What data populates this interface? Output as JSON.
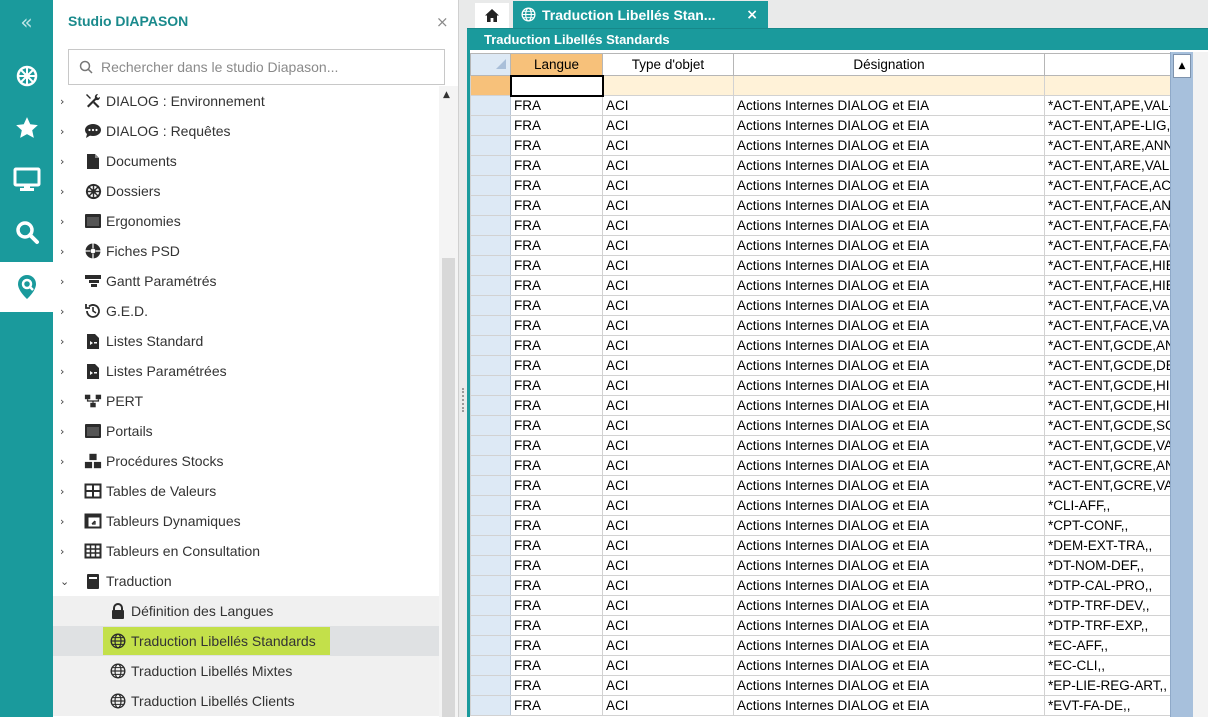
{
  "rail": {
    "collapse": "«",
    "items": [
      {
        "name": "dossier-wheel-icon",
        "active": false
      },
      {
        "name": "star-icon",
        "active": false
      },
      {
        "name": "monitor-icon",
        "active": false
      },
      {
        "name": "search-icon",
        "active": false
      },
      {
        "name": "map-search-icon",
        "active": true
      }
    ]
  },
  "panel": {
    "title": "Studio DIAPASON",
    "close": "×",
    "search_placeholder": "Rechercher dans le studio Diapason..."
  },
  "tree": {
    "items": [
      {
        "label": "DIALOG : Environnement",
        "icon": "tools-icon",
        "chevron": "›"
      },
      {
        "label": "DIALOG : Requêtes",
        "icon": "chat-bubble-icon",
        "chevron": "›"
      },
      {
        "label": "Documents",
        "icon": "document-icon",
        "chevron": "›"
      },
      {
        "label": "Dossiers",
        "icon": "gear-wheel-icon",
        "chevron": "›"
      },
      {
        "label": "Ergonomies",
        "icon": "window-icon",
        "chevron": "›"
      },
      {
        "label": "Fiches PSD",
        "icon": "puzzle-icon",
        "chevron": "›"
      },
      {
        "label": "Gantt Paramétrés",
        "icon": "gantt-icon",
        "chevron": "›"
      },
      {
        "label": "G.E.D.",
        "icon": "history-icon",
        "chevron": "›"
      },
      {
        "label": "Listes Standard",
        "icon": "file-list-icon",
        "chevron": "›"
      },
      {
        "label": "Listes Paramétrées",
        "icon": "file-list-icon",
        "chevron": "›"
      },
      {
        "label": "PERT",
        "icon": "network-icon",
        "chevron": "›"
      },
      {
        "label": "Portails",
        "icon": "window-icon",
        "chevron": "›"
      },
      {
        "label": "Procédures Stocks",
        "icon": "boxes-icon",
        "chevron": "›"
      },
      {
        "label": "Tables de Valeurs",
        "icon": "table-icon",
        "chevron": "›"
      },
      {
        "label": "Tableurs Dynamiques",
        "icon": "pivot-icon",
        "chevron": "›"
      },
      {
        "label": "Tableurs en Consultation",
        "icon": "grid-icon",
        "chevron": "›"
      },
      {
        "label": "Traduction",
        "icon": "book-icon",
        "chevron": "⌄"
      }
    ],
    "children": [
      {
        "label": "Définition des Langues",
        "icon": "lock-icon",
        "selected": false
      },
      {
        "label": "Traduction Libellés Standards",
        "icon": "globe-icon",
        "selected": true
      },
      {
        "label": "Traduction Libellés Mixtes",
        "icon": "globe-icon",
        "selected": false
      },
      {
        "label": "Traduction Libellés Clients",
        "icon": "globe-icon",
        "selected": false
      }
    ]
  },
  "tabs": {
    "home_icon": "home-icon",
    "active_label": "Traduction Libellés Stan...",
    "close": "×"
  },
  "subheader": "Traduction Libellés Standards",
  "grid": {
    "columns": [
      "Langue",
      "Type d'objet",
      "Désignation",
      ""
    ],
    "rows": [
      [
        "FRA",
        "ACI",
        "Actions Internes DIALOG et EIA",
        "*ACT-ENT,APE,VAL-"
      ],
      [
        "FRA",
        "ACI",
        "Actions Internes DIALOG et EIA",
        "*ACT-ENT,APE-LIG,A"
      ],
      [
        "FRA",
        "ACI",
        "Actions Internes DIALOG et EIA",
        "*ACT-ENT,ARE,ANN"
      ],
      [
        "FRA",
        "ACI",
        "Actions Internes DIALOG et EIA",
        "*ACT-ENT,ARE,VAL"
      ],
      [
        "FRA",
        "ACI",
        "Actions Internes DIALOG et EIA",
        "*ACT-ENT,FACE,ACI"
      ],
      [
        "FRA",
        "ACI",
        "Actions Internes DIALOG et EIA",
        "*ACT-ENT,FACE,AN"
      ],
      [
        "FRA",
        "ACI",
        "Actions Internes DIALOG et EIA",
        "*ACT-ENT,FACE,FAC"
      ],
      [
        "FRA",
        "ACI",
        "Actions Internes DIALOG et EIA",
        "*ACT-ENT,FACE,FAC"
      ],
      [
        "FRA",
        "ACI",
        "Actions Internes DIALOG et EIA",
        "*ACT-ENT,FACE,HIE"
      ],
      [
        "FRA",
        "ACI",
        "Actions Internes DIALOG et EIA",
        "*ACT-ENT,FACE,HIE"
      ],
      [
        "FRA",
        "ACI",
        "Actions Internes DIALOG et EIA",
        "*ACT-ENT,FACE,VAI"
      ],
      [
        "FRA",
        "ACI",
        "Actions Internes DIALOG et EIA",
        "*ACT-ENT,FACE,VAI"
      ],
      [
        "FRA",
        "ACI",
        "Actions Internes DIALOG et EIA",
        "*ACT-ENT,GCDE,AN"
      ],
      [
        "FRA",
        "ACI",
        "Actions Internes DIALOG et EIA",
        "*ACT-ENT,GCDE,DE"
      ],
      [
        "FRA",
        "ACI",
        "Actions Internes DIALOG et EIA",
        "*ACT-ENT,GCDE,HII"
      ],
      [
        "FRA",
        "ACI",
        "Actions Internes DIALOG et EIA",
        "*ACT-ENT,GCDE,HII"
      ],
      [
        "FRA",
        "ACI",
        "Actions Internes DIALOG et EIA",
        "*ACT-ENT,GCDE,SC"
      ],
      [
        "FRA",
        "ACI",
        "Actions Internes DIALOG et EIA",
        "*ACT-ENT,GCDE,VA"
      ],
      [
        "FRA",
        "ACI",
        "Actions Internes DIALOG et EIA",
        "*ACT-ENT,GCRE,AN"
      ],
      [
        "FRA",
        "ACI",
        "Actions Internes DIALOG et EIA",
        "*ACT-ENT,GCRE,VA"
      ],
      [
        "FRA",
        "ACI",
        "Actions Internes DIALOG et EIA",
        "*CLI-AFF,,"
      ],
      [
        "FRA",
        "ACI",
        "Actions Internes DIALOG et EIA",
        "*CPT-CONF,,"
      ],
      [
        "FRA",
        "ACI",
        "Actions Internes DIALOG et EIA",
        "*DEM-EXT-TRA,,"
      ],
      [
        "FRA",
        "ACI",
        "Actions Internes DIALOG et EIA",
        "*DT-NOM-DEF,,"
      ],
      [
        "FRA",
        "ACI",
        "Actions Internes DIALOG et EIA",
        "*DTP-CAL-PRO,,"
      ],
      [
        "FRA",
        "ACI",
        "Actions Internes DIALOG et EIA",
        "*DTP-TRF-DEV,,"
      ],
      [
        "FRA",
        "ACI",
        "Actions Internes DIALOG et EIA",
        "*DTP-TRF-EXP,,"
      ],
      [
        "FRA",
        "ACI",
        "Actions Internes DIALOG et EIA",
        "*EC-AFF,,"
      ],
      [
        "FRA",
        "ACI",
        "Actions Internes DIALOG et EIA",
        "*EC-CLI,,"
      ],
      [
        "FRA",
        "ACI",
        "Actions Internes DIALOG et EIA",
        "*EP-LIE-REG-ART,,"
      ],
      [
        "FRA",
        "ACI",
        "Actions Internes DIALOG et EIA",
        "*EVT-FA-DE,,"
      ]
    ]
  },
  "colors": {
    "accent": "#1a9a9c",
    "header_highlight": "#f7c17a",
    "selection": "#c3e04a"
  }
}
